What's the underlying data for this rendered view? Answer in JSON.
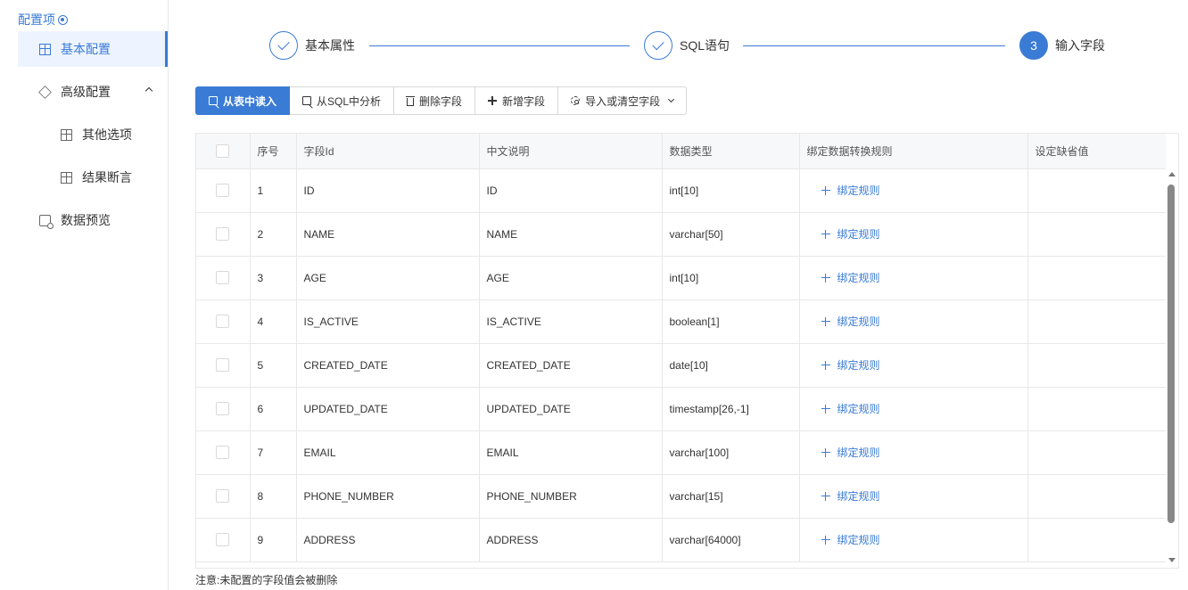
{
  "sidebar": {
    "title": "配置项",
    "items": [
      {
        "label": "基本配置"
      },
      {
        "label": "高级配置"
      },
      {
        "label": "其他选项"
      },
      {
        "label": "结果断言"
      },
      {
        "label": "数据预览"
      }
    ]
  },
  "steps": [
    {
      "label": "基本属性",
      "state": "done"
    },
    {
      "label": "SQL语句",
      "state": "done"
    },
    {
      "label": "输入字段",
      "state": "current",
      "number": "3"
    }
  ],
  "toolbar": {
    "read_from_table": "从表中读入",
    "analyze_sql": "从SQL中分析",
    "delete_field": "删除字段",
    "add_field": "新增字段",
    "import_clear": "导入或清空字段"
  },
  "table": {
    "headers": [
      "序号",
      "字段Id",
      "中文说明",
      "数据类型",
      "绑定数据转换规则",
      "设定缺省值"
    ],
    "bind_label": "绑定规则",
    "rows": [
      {
        "no": "1",
        "id": "ID",
        "desc": "ID",
        "type": "int[10]"
      },
      {
        "no": "2",
        "id": "NAME",
        "desc": "NAME",
        "type": "varchar[50]"
      },
      {
        "no": "3",
        "id": "AGE",
        "desc": "AGE",
        "type": "int[10]"
      },
      {
        "no": "4",
        "id": "IS_ACTIVE",
        "desc": "IS_ACTIVE",
        "type": "boolean[1]"
      },
      {
        "no": "5",
        "id": "CREATED_DATE",
        "desc": "CREATED_DATE",
        "type": "date[10]"
      },
      {
        "no": "6",
        "id": "UPDATED_DATE",
        "desc": "UPDATED_DATE",
        "type": "timestamp[26,-1]"
      },
      {
        "no": "7",
        "id": "EMAIL",
        "desc": "EMAIL",
        "type": "varchar[100]"
      },
      {
        "no": "8",
        "id": "PHONE_NUMBER",
        "desc": "PHONE_NUMBER",
        "type": "varchar[15]"
      },
      {
        "no": "9",
        "id": "ADDRESS",
        "desc": "ADDRESS",
        "type": "varchar[64000]"
      }
    ]
  },
  "note": "注意:未配置的字段值会被删除",
  "colors": {
    "accent": "#3a7bd5"
  }
}
